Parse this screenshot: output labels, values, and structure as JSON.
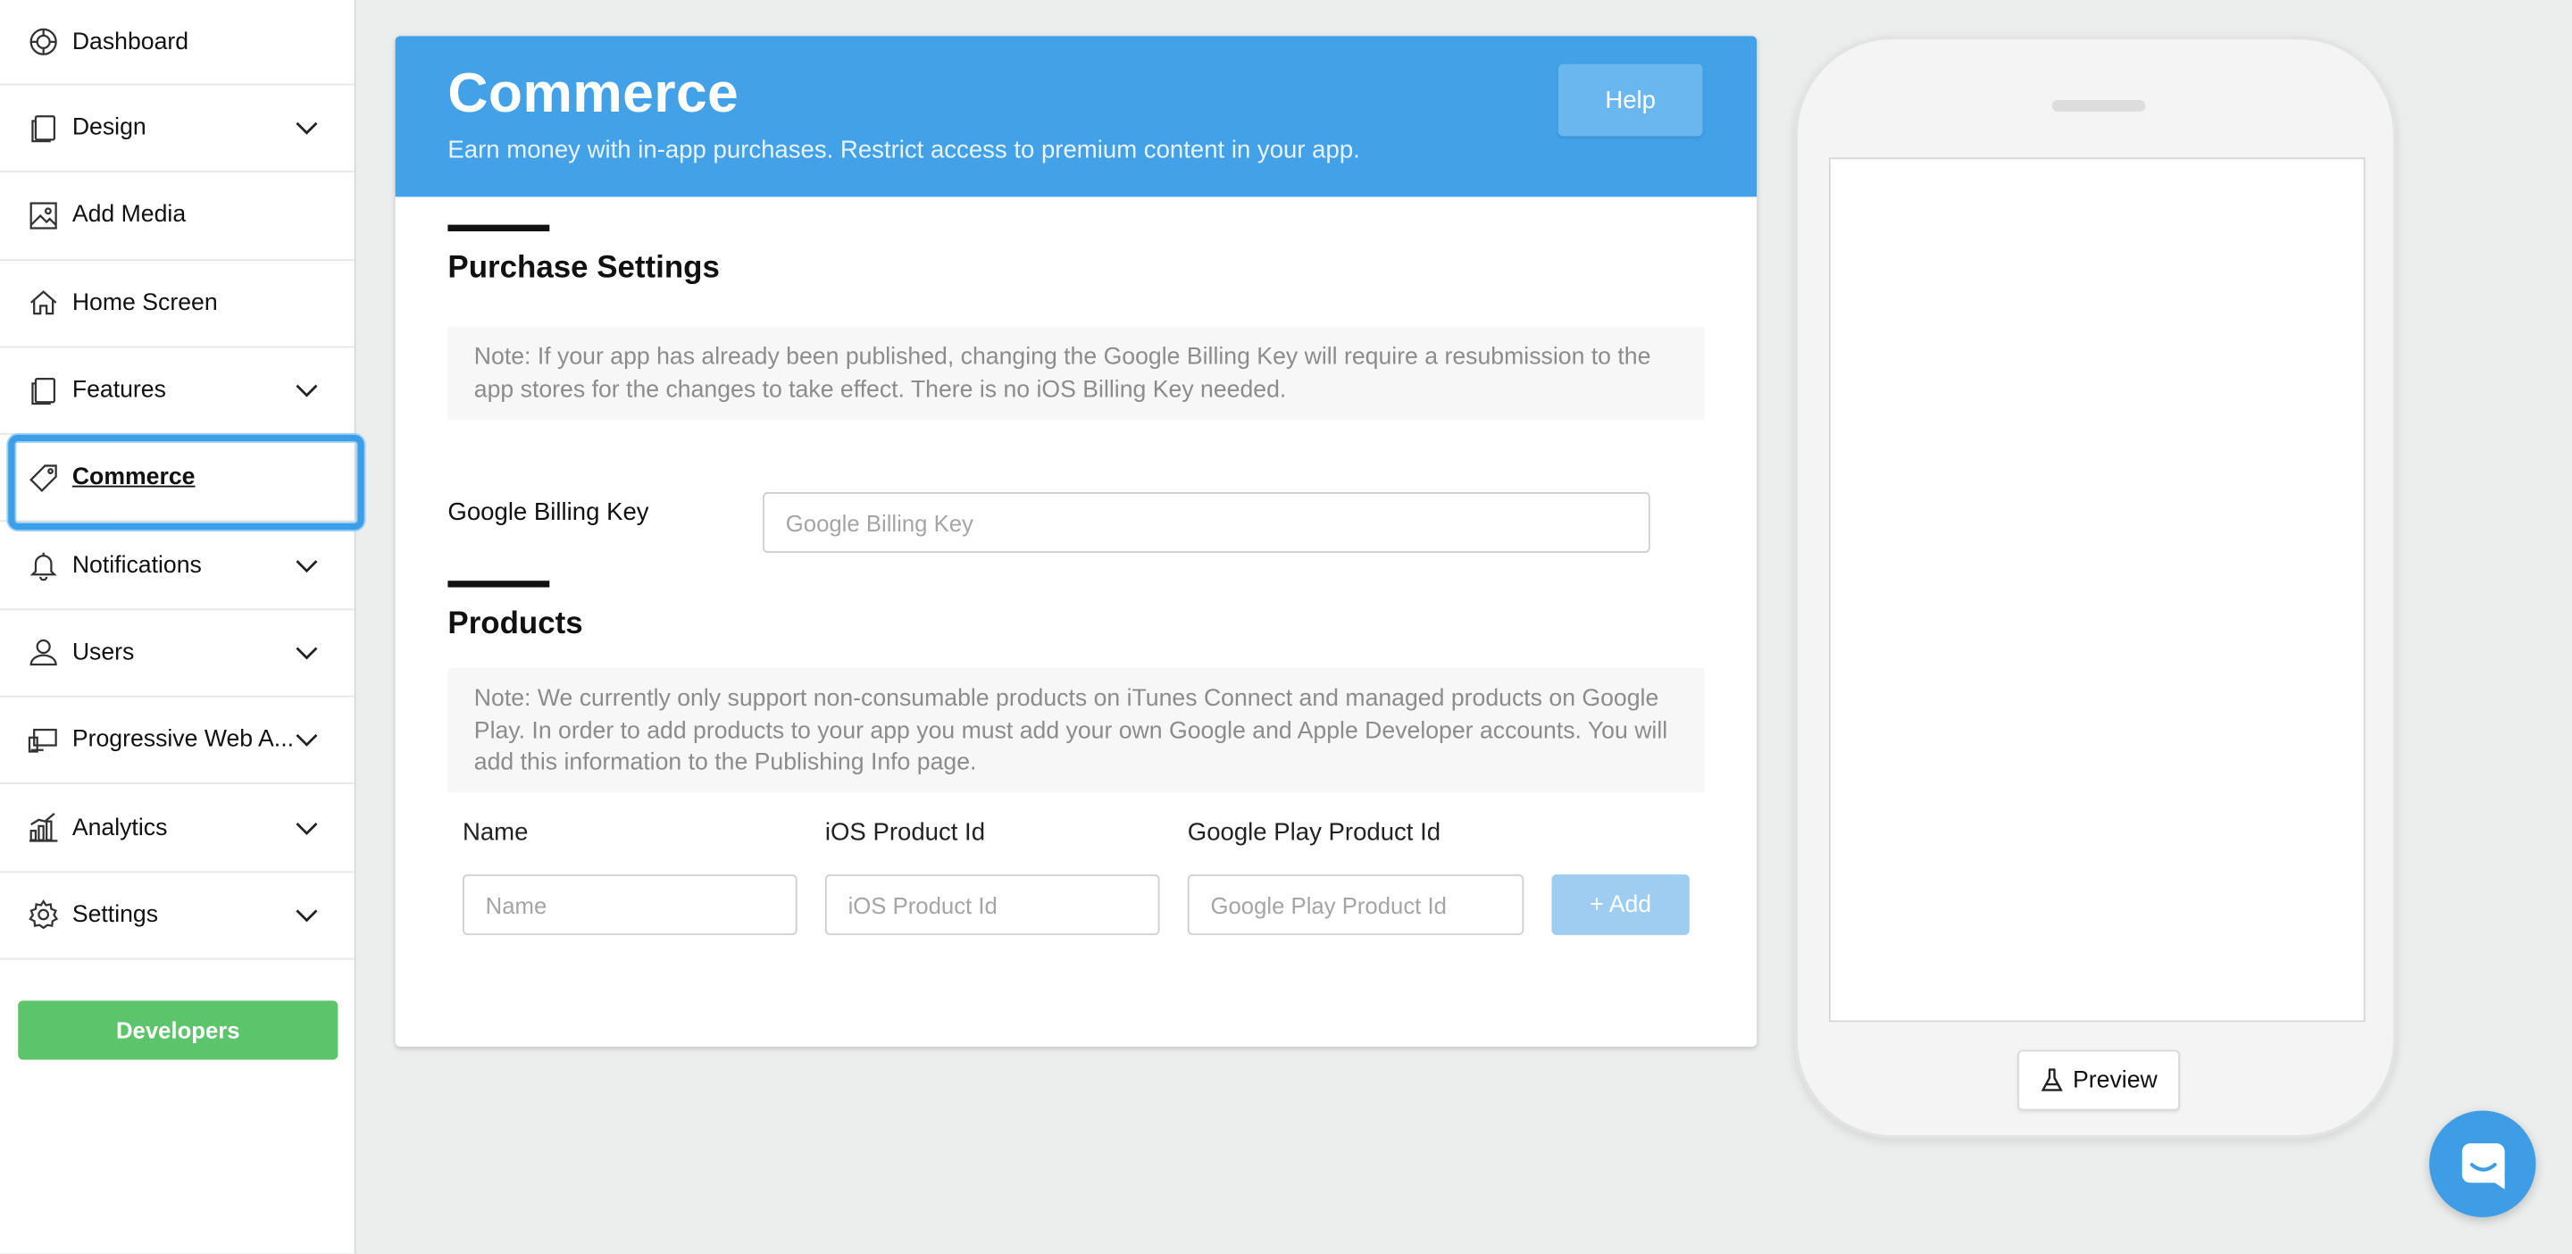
{
  "sidebar": {
    "items": [
      {
        "label": "Dashboard",
        "icon": "dashboard-icon",
        "has_chevron": false
      },
      {
        "label": "Design",
        "icon": "design-icon",
        "has_chevron": true
      },
      {
        "label": "Add Media",
        "icon": "image-icon",
        "has_chevron": false
      },
      {
        "label": "Home Screen",
        "icon": "home-icon",
        "has_chevron": false
      },
      {
        "label": "Features",
        "icon": "features-icon",
        "has_chevron": true
      },
      {
        "label": "Commerce",
        "icon": "tag-icon",
        "has_chevron": false,
        "active": true
      },
      {
        "label": "Notifications",
        "icon": "bell-icon",
        "has_chevron": true
      },
      {
        "label": "Users",
        "icon": "user-icon",
        "has_chevron": true
      },
      {
        "label": "Progressive Web A...",
        "icon": "devices-icon",
        "has_chevron": true
      },
      {
        "label": "Analytics",
        "icon": "bar-chart-icon",
        "has_chevron": true
      },
      {
        "label": "Settings",
        "icon": "gear-icon",
        "has_chevron": true
      }
    ],
    "developers_label": "Developers"
  },
  "header": {
    "title": "Commerce",
    "subtitle": "Earn money with in-app purchases. Restrict access to premium content in your app.",
    "help_label": "Help"
  },
  "purchase_settings": {
    "title": "Purchase Settings",
    "note": "Note: If your app has already been published, changing the Google Billing Key will require a resubmission to the app stores for the changes to take effect. There is no iOS Billing Key needed.",
    "billing_key_label": "Google Billing Key",
    "billing_key_placeholder": "Google Billing Key",
    "billing_key_value": ""
  },
  "products": {
    "title": "Products",
    "note": "Note: We currently only support non-consumable products on iTunes Connect and managed products on Google Play. In order to add products to your app you must add your own Google and Apple Developer accounts. You will add this information to the Publishing Info page.",
    "columns": [
      "Name",
      "iOS Product Id",
      "Google Play Product Id"
    ],
    "placeholders": {
      "name": "Name",
      "ios": "iOS Product Id",
      "google": "Google Play Product Id"
    },
    "add_label": "+ Add"
  },
  "phone": {
    "preview_label": "Preview"
  },
  "colors": {
    "header_blue": "#43a1e8",
    "developers_green": "#5cc46b",
    "add_button_blue": "#9fcdf2",
    "chat_blue": "#3f9de6"
  }
}
